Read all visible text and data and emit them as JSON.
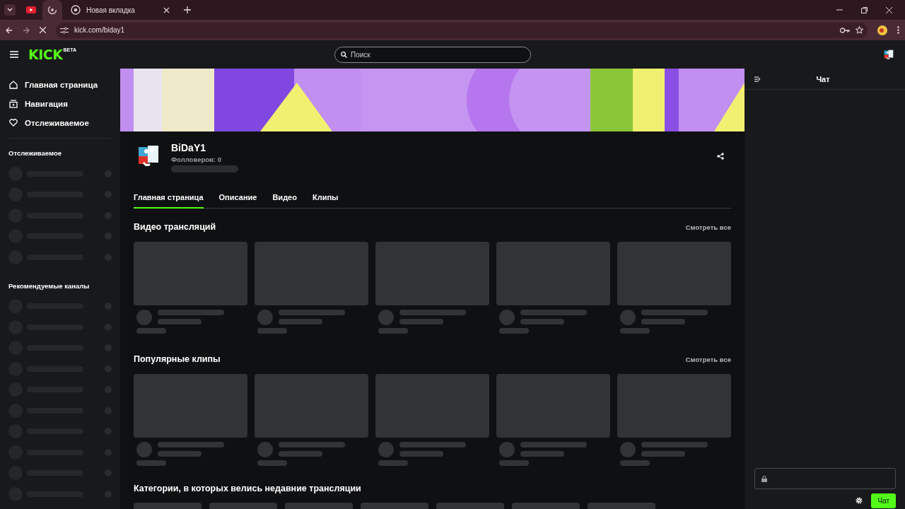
{
  "browser": {
    "tabs": [
      {
        "kind": "video",
        "selected": false
      },
      {
        "kind": "loading",
        "selected": true
      },
      {
        "kind": "globe",
        "title": "Новая вкладка",
        "selected": false
      }
    ],
    "address": "kick.com/biday1"
  },
  "header": {
    "logo": "KICK",
    "logo_badge": "BETA",
    "search_placeholder": "Поиск"
  },
  "sidebar": {
    "nav": [
      {
        "kind": "home",
        "label": "Главная страница"
      },
      {
        "kind": "browse",
        "label": "Навигация"
      },
      {
        "kind": "heart",
        "label": "Отслеживаемое"
      }
    ],
    "sections": [
      {
        "title": "Отслеживаемое"
      },
      {
        "title": "Рекомендуемые каналы"
      }
    ]
  },
  "channel": {
    "name": "BiDaY1",
    "followers": "Фолловеров: 0"
  },
  "tabs": [
    {
      "label": "Главная страница",
      "selected": true
    },
    {
      "label": "Описание",
      "selected": false
    },
    {
      "label": "Видео",
      "selected": false
    },
    {
      "label": "Клипы",
      "selected": false
    }
  ],
  "sections": [
    {
      "kind": "videos",
      "title": "Видео трансляций",
      "see_all": "Смотреть все"
    },
    {
      "kind": "videos",
      "title": "Популярные клипы",
      "see_all": "Смотреть все"
    },
    {
      "kind": "categories",
      "title": "Категории, в которых велись недавние трансляции"
    }
  ],
  "chat": {
    "title": "Чат",
    "send": "Чат"
  }
}
